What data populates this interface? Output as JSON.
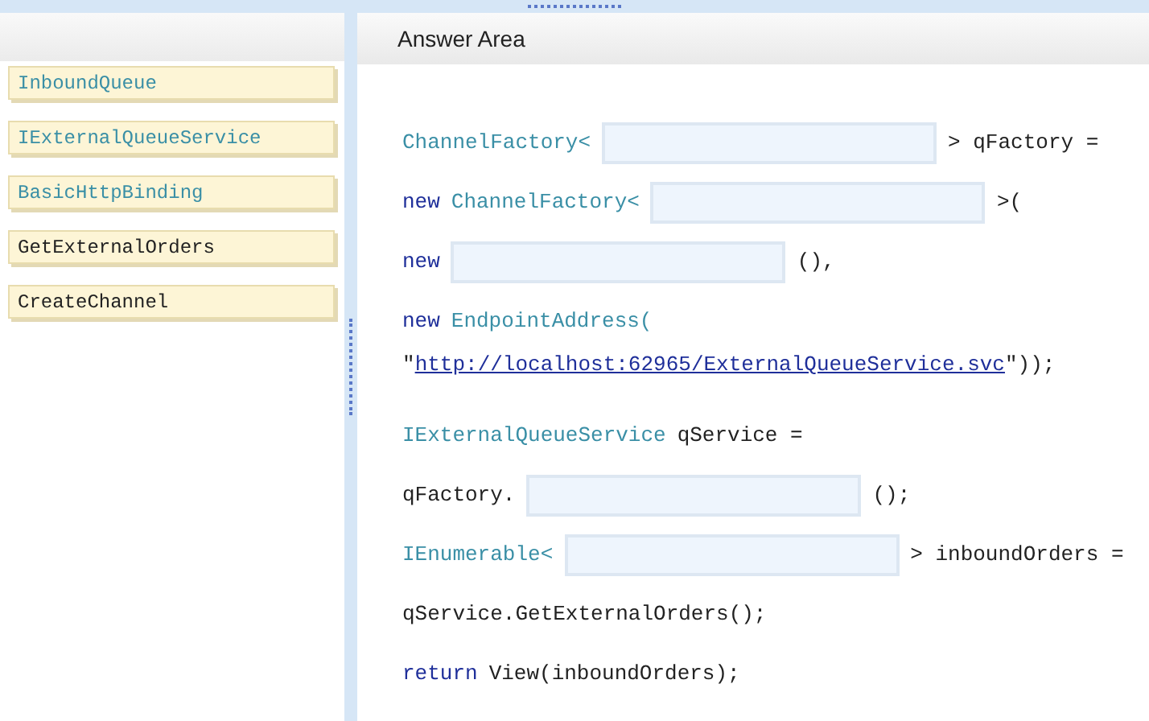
{
  "answer_area": {
    "title": "Answer Area"
  },
  "choices": [
    {
      "text": "InboundQueue",
      "kind": "type"
    },
    {
      "text": "IExternalQueueService",
      "kind": "type"
    },
    {
      "text": "BasicHttpBinding",
      "kind": "type"
    },
    {
      "text": "GetExternalOrders",
      "kind": "plain"
    },
    {
      "text": "CreateChannel",
      "kind": "plain"
    }
  ],
  "code_lines": [
    {
      "kind": "line",
      "segments": [
        {
          "kind": "type",
          "text": "ChannelFactory<"
        },
        {
          "kind": "slot"
        },
        {
          "kind": "plain",
          "text": "> qFactory ="
        }
      ]
    },
    {
      "kind": "line",
      "segments": [
        {
          "kind": "keyword",
          "text": "new"
        },
        {
          "kind": "type",
          "text": "ChannelFactory<"
        },
        {
          "kind": "slot"
        },
        {
          "kind": "plain",
          "text": ">("
        }
      ]
    },
    {
      "kind": "line",
      "segments": [
        {
          "kind": "keyword",
          "text": "new"
        },
        {
          "kind": "slot"
        },
        {
          "kind": "plain",
          "text": "(),"
        }
      ]
    },
    {
      "kind": "line",
      "segments": [
        {
          "kind": "keyword",
          "text": "new"
        },
        {
          "kind": "type",
          "text": "EndpointAddress("
        }
      ]
    },
    {
      "kind": "continuation",
      "segments": [
        {
          "kind": "plain",
          "text": "\""
        },
        {
          "kind": "link",
          "text": "http://localhost:62965/ExternalQueueService.svc"
        },
        {
          "kind": "plain",
          "text": "\"));"
        }
      ]
    },
    {
      "kind": "line",
      "segments": [
        {
          "kind": "type",
          "text": "IExternalQueueService"
        },
        {
          "kind": "plain",
          "text": "qService ="
        }
      ]
    },
    {
      "kind": "line",
      "segments": [
        {
          "kind": "plain",
          "text": "qFactory."
        },
        {
          "kind": "slot"
        },
        {
          "kind": "plain",
          "text": "();"
        }
      ]
    },
    {
      "kind": "line",
      "segments": [
        {
          "kind": "type",
          "text": "IEnumerable<"
        },
        {
          "kind": "slot"
        },
        {
          "kind": "plain",
          "text": "> inboundOrders ="
        }
      ]
    },
    {
      "kind": "line",
      "segments": [
        {
          "kind": "plain",
          "text": "qService.GetExternalOrders();"
        }
      ]
    },
    {
      "kind": "line",
      "segments": [
        {
          "kind": "keyword",
          "text": "return"
        },
        {
          "kind": "plain",
          "text": "View(inboundOrders);"
        }
      ]
    }
  ]
}
